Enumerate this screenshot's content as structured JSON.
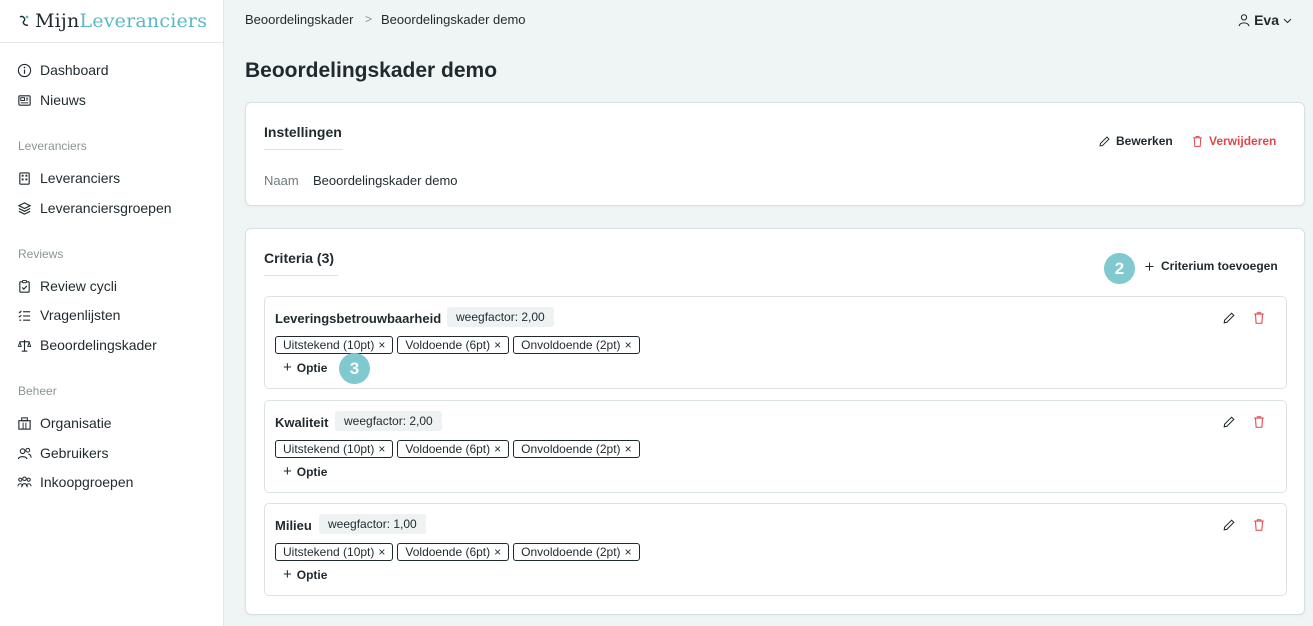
{
  "logo": {
    "part1": "Mijn",
    "part2": "Leveranciers"
  },
  "sidebar": {
    "items_top": [
      {
        "label": "Dashboard",
        "icon": "info-icon"
      },
      {
        "label": "Nieuws",
        "icon": "newspaper-icon"
      }
    ],
    "section_leveranciers": "Leveranciers",
    "items_leveranciers": [
      {
        "label": "Leveranciers",
        "icon": "building-icon"
      },
      {
        "label": "Leveranciersgroepen",
        "icon": "layers-icon"
      }
    ],
    "section_reviews": "Reviews",
    "items_reviews": [
      {
        "label": "Review cycli",
        "icon": "clipboard-check-icon"
      },
      {
        "label": "Vragenlijsten",
        "icon": "list-check-icon"
      },
      {
        "label": "Beoordelingskader",
        "icon": "scale-icon"
      }
    ],
    "section_beheer": "Beheer",
    "items_beheer": [
      {
        "label": "Organisatie",
        "icon": "office-icon"
      },
      {
        "label": "Gebruikers",
        "icon": "users-icon"
      },
      {
        "label": "Inkoopgroepen",
        "icon": "group-icon"
      }
    ]
  },
  "breadcrumb": {
    "item1": "Beoordelingskader",
    "separator": ">",
    "item2": "Beoordelingskader demo"
  },
  "user": {
    "name": "Eva"
  },
  "page": {
    "title": "Beoordelingskader demo"
  },
  "settings": {
    "title": "Instellingen",
    "edit_label": "Bewerken",
    "delete_label": "Verwijderen",
    "name_label": "Naam",
    "name_value": "Beoordelingskader demo"
  },
  "criteria": {
    "title": "Criteria (3)",
    "add_label": "Criterium toevoegen",
    "add_option_label": "Optie",
    "items": [
      {
        "name": "Leveringsbetrouwbaarheid",
        "weight": "weegfactor: 2,00",
        "options": [
          "Uitstekend (10pt)",
          "Voldoende (6pt)",
          "Onvoldoende (2pt)"
        ]
      },
      {
        "name": "Kwaliteit",
        "weight": "weegfactor: 2,00",
        "options": [
          "Uitstekend (10pt)",
          "Voldoende (6pt)",
          "Onvoldoende (2pt)"
        ]
      },
      {
        "name": "Milieu",
        "weight": "weegfactor: 1,00",
        "options": [
          "Uitstekend (10pt)",
          "Voldoende (6pt)",
          "Onvoldoende (2pt)"
        ]
      }
    ]
  },
  "steps": {
    "step2": "2",
    "step3": "3"
  },
  "colors": {
    "accent": "#5bb9c4",
    "danger": "#e0464a",
    "step_marker": "#7fc9cf",
    "background": "#eff4f4"
  }
}
